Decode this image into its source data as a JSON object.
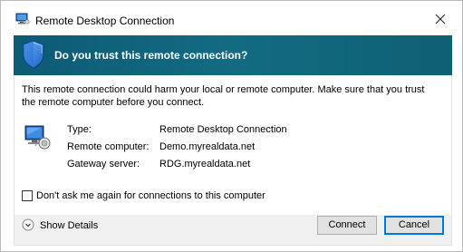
{
  "window": {
    "title": "Remote Desktop Connection",
    "icons": {
      "app": "remote-desktop-icon",
      "close": "close-icon"
    }
  },
  "banner": {
    "text": "Do you trust this remote connection?",
    "icon": "shield-icon",
    "color": "#0d5a74"
  },
  "content": {
    "warning": "This remote connection could harm your local or remote computer. Make sure that you trust the remote computer before you connect.",
    "icon": "rdp-connection-icon",
    "info": [
      {
        "label": "Type:",
        "value": "Remote Desktop Connection"
      },
      {
        "label": "Remote computer:",
        "value": "Demo.myrealdata.net"
      },
      {
        "label": "Gateway server:",
        "value": "RDG.myrealdata.net"
      }
    ],
    "checkbox": {
      "label": "Don't ask me again for connections to this computer",
      "checked": false
    }
  },
  "footer": {
    "show_details": "Show Details",
    "connect_label": "Connect",
    "cancel_label": "Cancel"
  }
}
